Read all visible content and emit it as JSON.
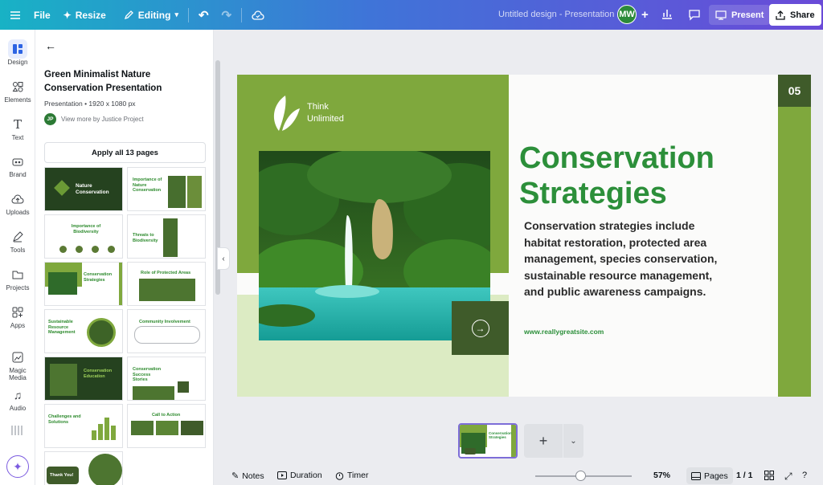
{
  "topbar": {
    "file": "File",
    "resize": "Resize",
    "editing": "Editing",
    "title": "Untitled design - Presentation",
    "avatar": "MW",
    "present": "Present",
    "share": "Share"
  },
  "rail": [
    {
      "label": "Design",
      "icon": "design-icon"
    },
    {
      "label": "Elements",
      "icon": "elements-icon"
    },
    {
      "label": "Text",
      "icon": "text-icon"
    },
    {
      "label": "Brand",
      "icon": "brand-icon"
    },
    {
      "label": "Uploads",
      "icon": "uploads-icon"
    },
    {
      "label": "Tools",
      "icon": "tools-icon"
    },
    {
      "label": "Projects",
      "icon": "projects-icon"
    },
    {
      "label": "Apps",
      "icon": "apps-icon"
    },
    {
      "label": "Magic Media",
      "icon": "magic-media-icon"
    },
    {
      "label": "Audio",
      "icon": "audio-icon"
    }
  ],
  "panel": {
    "title": "Green Minimalist Nature Conservation Presentation",
    "subtitle": "Presentation • 1920 x 1080 px",
    "author_initials": "JP",
    "author_link": "View more by Justice Project",
    "apply_all": "Apply all 13 pages",
    "thumbs": [
      {
        "title": "Nature Conservation"
      },
      {
        "title": "Importance of Nature Conservation"
      },
      {
        "title": "Importance of Biodiversity"
      },
      {
        "title": "Threats to Biodiversity"
      },
      {
        "title": "Conservation Strategies"
      },
      {
        "title": "Role of Protected Areas"
      },
      {
        "title": "Sustainable Resource Management"
      },
      {
        "title": "Community Involvement"
      },
      {
        "title": "Conservation Education"
      },
      {
        "title": "Conservation Success Stories"
      },
      {
        "title": "Challenges and Solutions"
      },
      {
        "title": "Call to Action"
      },
      {
        "title": "Thank You!"
      }
    ]
  },
  "slide": {
    "logo_line1": "Think",
    "logo_line2": "Unlimited",
    "page_number": "05",
    "heading_line1": "Conservation",
    "heading_line2": "Strategies",
    "body": "Conservation strategies include habitat restoration, protected area management, species conservation, sustainable resource management, and public awareness campaigns.",
    "url": "www.reallygreatsite.com"
  },
  "strip": {
    "thumb_title": "Conservation Strategies",
    "add": "+"
  },
  "bottombar": {
    "notes": "Notes",
    "duration": "Duration",
    "timer": "Timer",
    "zoom": "57%",
    "pages": "Pages",
    "page_count": "1 / 1",
    "zoom_level": 0.47
  },
  "colors": {
    "slide_green": "#7fa83d",
    "slide_dark": "#3f5b2a",
    "heading": "#2c8f3a"
  }
}
